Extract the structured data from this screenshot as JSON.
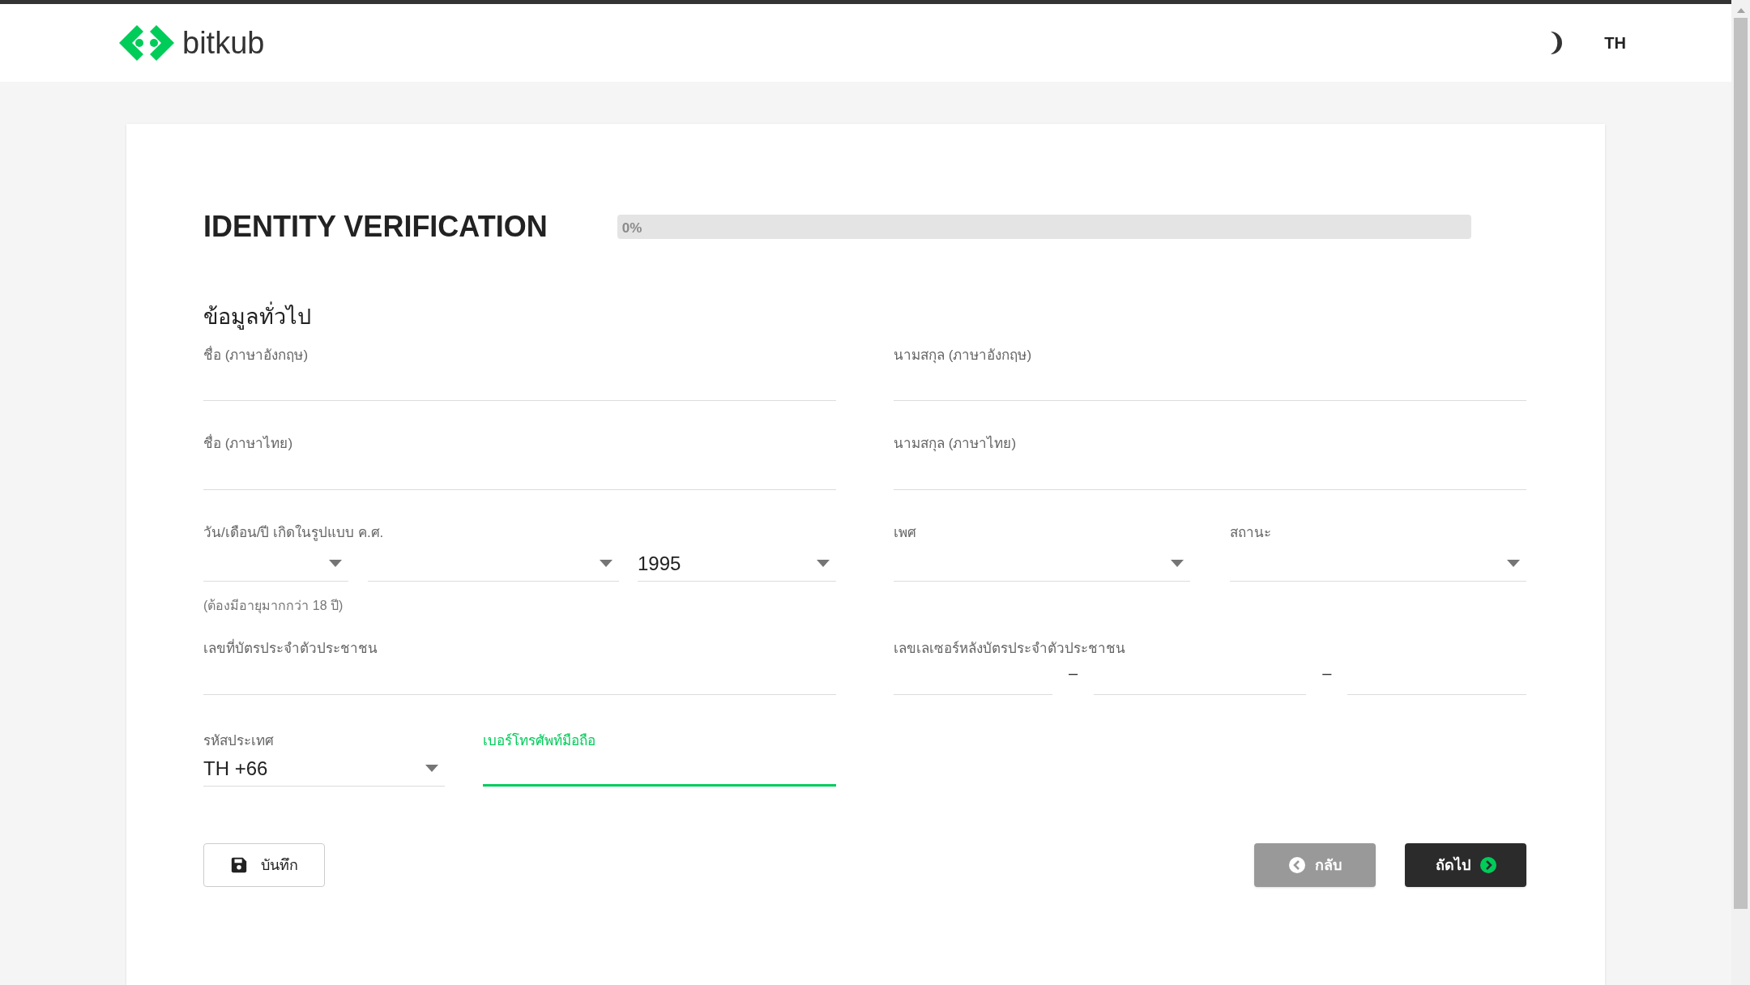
{
  "header": {
    "logo_text": "bitkub",
    "language": "TH"
  },
  "title": "IDENTITY VERIFICATION",
  "progress": {
    "label": "0%",
    "level": 0
  },
  "section_title": "ข้อมูลทั่วไป",
  "name_rows": [
    [
      {
        "label": "ชื่อ (ภาษาอังกฤษ)",
        "focused": false
      },
      {
        "label": "นามสกุล (ภาษาอังกฤษ)",
        "focused": false
      }
    ],
    [
      {
        "label": "ชื่อ (ภาษาไทย)",
        "focused": false
      },
      {
        "label": "นามสกุล (ภาษาไทย)",
        "focused": false
      }
    ]
  ],
  "birth_date": {
    "label": "วัน/เดือน/ปี เกิดในรูปแบบ ค.ศ.",
    "selects": [
      {
        "kind": "day"
      },
      {
        "kind": "month"
      },
      {
        "kind": "year",
        "value": "1995"
      }
    ],
    "helper": "(ต้องมีอายุมากกว่า 18 ปี)"
  },
  "gender": {
    "label": "เพศ"
  },
  "marital_status": {
    "label": "สถานะ"
  },
  "id_number": {
    "label": "เลขที่บัตรประจำตัวประชาชน",
    "focused": false
  },
  "laser_code": {
    "label": "เลขเลเซอร์หลังบัตรประจำตัวประชาชน",
    "separators": [
      "–",
      "–"
    ]
  },
  "country_code": {
    "label": "รหัสประเทศ",
    "value": "TH +66"
  },
  "phone": {
    "label": "เบอร์โทรศัพท์มือถือ",
    "focused": true
  },
  "buttons": [
    {
      "kind": "save",
      "label": "บันทึก"
    },
    {
      "kind": "back",
      "label": "กลับ"
    },
    {
      "kind": "next",
      "label": "ถัดไป"
    }
  ]
}
